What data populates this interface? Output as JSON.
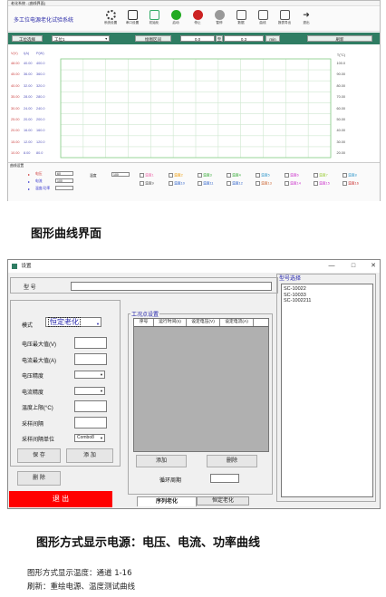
{
  "top_window": {
    "title": "老化系统 - [曲线界面]",
    "brand": "多工位电源老化试验系统",
    "toolbar": [
      {
        "label": "系统设置",
        "icon": "gear-icon"
      },
      {
        "label": "串口设置",
        "icon": "port-icon"
      },
      {
        "label": "初始化",
        "icon": "refresh-icon"
      },
      {
        "label": "启动",
        "icon": "start-icon"
      },
      {
        "label": "停止",
        "icon": "stop-icon"
      },
      {
        "label": "暂停",
        "icon": "pause-icon"
      },
      {
        "label": "数据",
        "icon": "data-icon"
      },
      {
        "label": "曲线",
        "icon": "curve-icon"
      },
      {
        "label": "报表导出",
        "icon": "report-icon"
      },
      {
        "label": "退出",
        "icon": "exit-icon"
      }
    ],
    "settings_bar": {
      "station_button": "工位选择",
      "station_value": "工位1",
      "range_label": "绘图区间",
      "range_start": "0.0",
      "range_to": "至",
      "range_end": "0.3",
      "unit": "min",
      "refresh_button": "刷新"
    },
    "chart_axes": {
      "left_headers": [
        "V(V)",
        "I(A)",
        "P(W)"
      ],
      "left_ticks": [
        [
          "48.00",
          "40.00",
          "400.0"
        ],
        [
          "45.00",
          "36.00",
          "360.0"
        ],
        [
          "40.00",
          "32.00",
          "320.0"
        ],
        [
          "35.00",
          "28.00",
          "280.0"
        ],
        [
          "30.00",
          "24.00",
          "240.0"
        ],
        [
          "25.00",
          "20.00",
          "200.0"
        ],
        [
          "20.00",
          "16.00",
          "160.0"
        ],
        [
          "15.00",
          "12.00",
          "120.0"
        ],
        [
          "10.00",
          "8.00",
          "80.0"
        ]
      ],
      "right_header": "T(°C)",
      "right_ticks": [
        "100.0",
        "90.00",
        "80.00",
        "70.00",
        "60.00",
        "50.00",
        "40.00",
        "30.00",
        "20.00"
      ]
    },
    "bottom": {
      "title": "曲线设置",
      "rows": [
        {
          "key": "电压",
          "label": "电压",
          "value": "60"
        },
        {
          "key": "电流",
          "label": "电流",
          "value": "100"
        },
        {
          "key": "功率",
          "label": "温度/功率",
          "value": ""
        }
      ],
      "temp_label": "温度",
      "temp_value": "100",
      "channels": [
        "温度1",
        "温度2",
        "温度3",
        "温度4",
        "温度5",
        "温度6",
        "温度7",
        "温度8",
        "温度9",
        "温度10",
        "温度11",
        "温度12",
        "温度13",
        "温度14",
        "温度15",
        "温度16"
      ]
    },
    "colors": {
      "bar": "#2f7d63",
      "brand": "#2a2aa8"
    }
  },
  "caption1": "图形曲线界面",
  "settings_window": {
    "title": "设置",
    "model_label": "型  号",
    "model_value": "",
    "mode_label": "模式",
    "mode_value": "恒定老化",
    "fields": [
      {
        "label": "电压最大值(V)",
        "type": "input",
        "value": ""
      },
      {
        "label": "电流最大值(A)",
        "type": "input",
        "value": ""
      },
      {
        "label": "电压精度",
        "type": "select",
        "value": ""
      },
      {
        "label": "电流精度",
        "type": "select",
        "value": ""
      },
      {
        "label": "温度上限(°C)",
        "type": "input",
        "value": ""
      },
      {
        "label": "采样间隔",
        "type": "input",
        "value": ""
      },
      {
        "label": "采样间隔单位",
        "type": "select",
        "value": "Combo8"
      }
    ],
    "save_button": "保  存",
    "add_button": "添  加",
    "delete_button": "删  除",
    "exit_button": "退  出",
    "workpoint_title": "工况点设置",
    "table_headers": [
      "序号",
      "运行时间(s)",
      "设定电压(V)",
      "设定电流(A)"
    ],
    "add_point_button": "添加",
    "delete_point_button": "删除",
    "cycle_label": "循环周期",
    "cycle_value": "",
    "tabs": [
      "序列老化",
      "恒定老化"
    ],
    "model_list_title": "型号选择",
    "model_list": [
      "SC-10022",
      "SC-10033",
      "SC-1002211"
    ],
    "window_controls": {
      "minimize": "—",
      "maximize": "□",
      "close": "✕"
    }
  },
  "caption2": "图形方式显示电源：电压、电流、功率曲线",
  "note_line1": "图形方式显示温度：通道 1-16",
  "note_line2": "刷新：重绘电源、温度测试曲线"
}
